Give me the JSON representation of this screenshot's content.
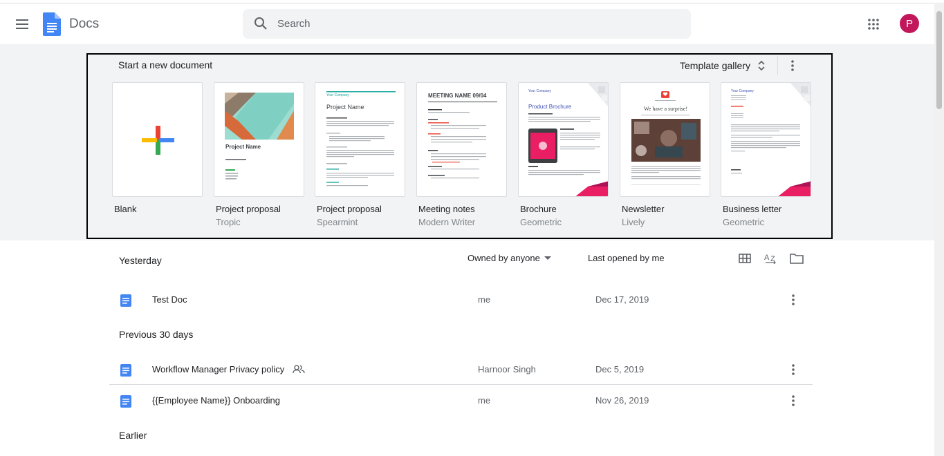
{
  "app": {
    "name": "Docs"
  },
  "search": {
    "placeholder": "Search"
  },
  "account": {
    "initial": "P",
    "color": "#c2185b"
  },
  "templates": {
    "heading": "Start a new document",
    "gallery_label": "Template gallery",
    "items": [
      {
        "name": "Blank",
        "subtitle": ""
      },
      {
        "name": "Project proposal",
        "subtitle": "Tropic"
      },
      {
        "name": "Project proposal",
        "subtitle": "Spearmint"
      },
      {
        "name": "Meeting notes",
        "subtitle": "Modern Writer"
      },
      {
        "name": "Brochure",
        "subtitle": "Geometric"
      },
      {
        "name": "Newsletter",
        "subtitle": "Lively"
      },
      {
        "name": "Business letter",
        "subtitle": "Geometric"
      }
    ],
    "thumb_text": {
      "tropic_title": "Project Name",
      "spearmint_company": "Your Company",
      "spearmint_title": "Project Name",
      "meeting_title": "MEETING NAME 09/04",
      "brochure_company": "Your Company",
      "brochure_title": "Product Brochure",
      "newsletter_headline": "We have a surprise!",
      "letter_company": "Your Company"
    }
  },
  "list": {
    "owner_filter": "Owned by anyone",
    "sort_label": "Last opened by me",
    "sections": {
      "yesterday": "Yesterday",
      "prev30": "Previous 30 days",
      "earlier": "Earlier"
    },
    "docs": [
      {
        "title": "Test Doc",
        "owner": "me",
        "date": "Dec 17, 2019",
        "shared": false
      },
      {
        "title": "Workflow Manager Privacy policy",
        "owner": "Harnoor Singh",
        "date": "Dec 5, 2019",
        "shared": true
      },
      {
        "title": "{{Employee Name}} Onboarding",
        "owner": "me",
        "date": "Nov 26, 2019",
        "shared": false
      }
    ]
  },
  "colors": {
    "docs_blue": "#4285f4",
    "band_bg": "#f1f3f4",
    "accent_pink": "#c2185b"
  }
}
